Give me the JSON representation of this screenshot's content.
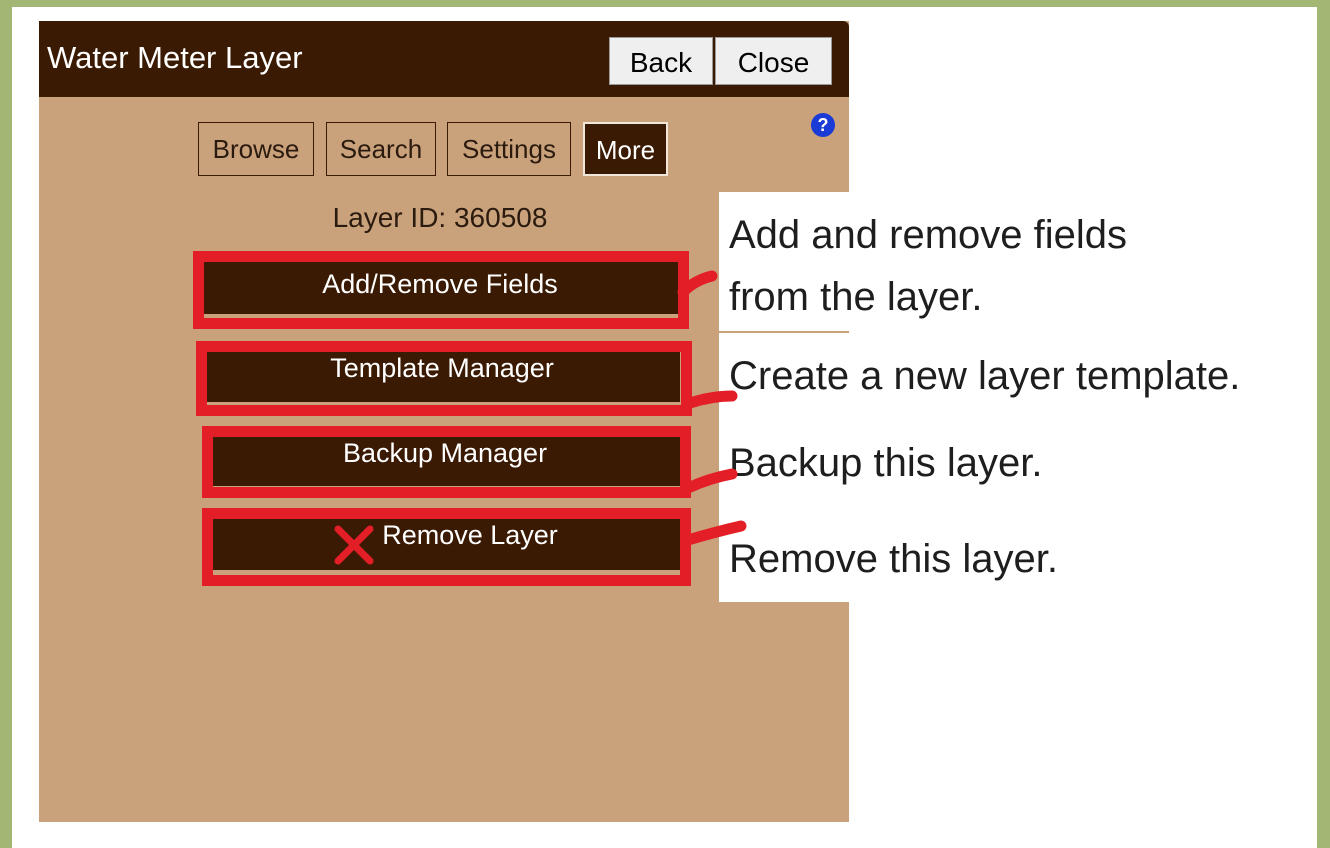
{
  "window": {
    "title": "Water Meter Layer",
    "back_label": "Back",
    "close_label": "Close",
    "help_icon": "?"
  },
  "tabs": [
    {
      "label": "Browse",
      "active": false
    },
    {
      "label": "Search",
      "active": false
    },
    {
      "label": "Settings",
      "active": false
    },
    {
      "label": "More",
      "active": true
    }
  ],
  "layer_id_text": "Layer ID: 360508",
  "actions": [
    {
      "label": "Add/Remove Fields"
    },
    {
      "label": "Template Manager"
    },
    {
      "label": "Backup Manager"
    },
    {
      "label": "Remove Layer",
      "icon": "red-x-icon"
    }
  ],
  "annotations": [
    {
      "line1": "Add and remove fields",
      "line2": "from the layer."
    },
    {
      "text": "Create a new layer template."
    },
    {
      "text": "Backup this layer."
    },
    {
      "text": "Remove this layer."
    }
  ],
  "colors": {
    "outer_bg": "#a3b775",
    "panel_bg": "#c9a27c",
    "header_bg": "#3b1a03",
    "highlight": "#e41e26",
    "help_icon": "#1a3bd6"
  }
}
